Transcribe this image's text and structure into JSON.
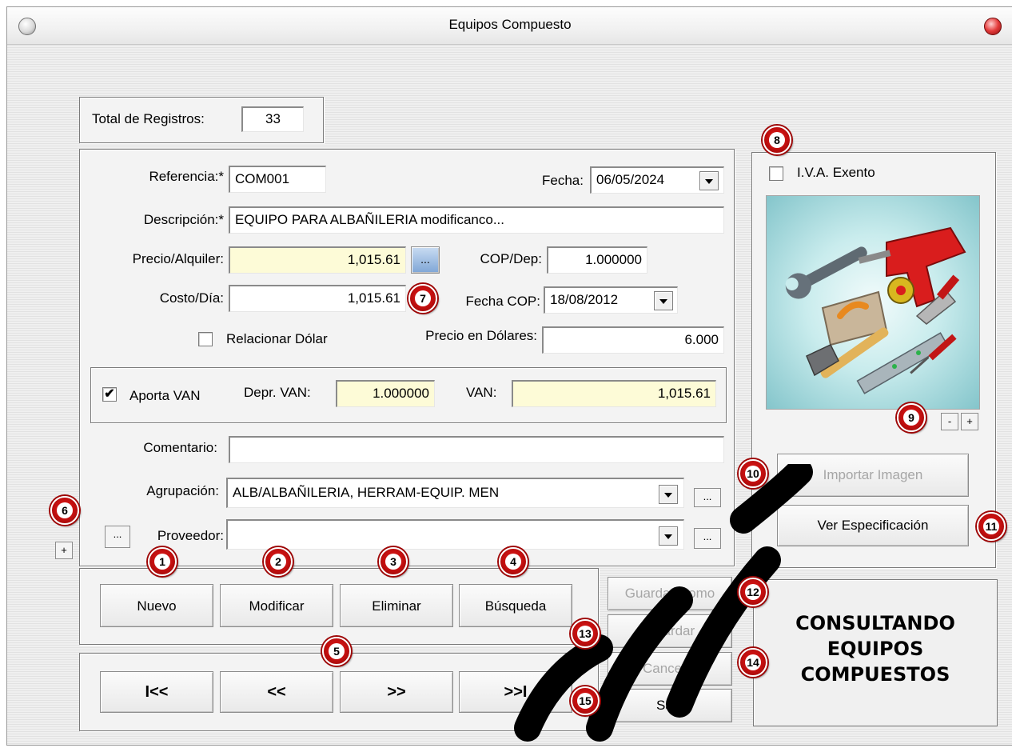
{
  "window": {
    "title": "Equipos Compuesto"
  },
  "total": {
    "label": "Total de Registros:",
    "value": "33"
  },
  "form": {
    "referencia_label": "Referencia:*",
    "referencia_value": "COM001",
    "fecha_label": "Fecha:",
    "fecha_value": "06/05/2024",
    "descripcion_label": "Descripción:*",
    "descripcion_value": "EQUIPO PARA ALBAÑILERIA modificanco...",
    "precio_label": "Precio/Alquiler:",
    "precio_value": "1,015.61",
    "ellipsis": "...",
    "cop_label": "COP/Dep:",
    "cop_value": "1.000000",
    "costo_label": "Costo/Día:",
    "costo_value": "1,015.61",
    "fecha_cop_label": "Fecha COP:",
    "fecha_cop_value": "18/08/2012",
    "relacionar_label": "Relacionar Dólar",
    "precio_dolares_label": "Precio en Dólares:",
    "precio_dolares_value": "6.000",
    "aporta_van_label": "Aporta VAN",
    "aporta_van_checked": true,
    "depr_van_label": "Depr. VAN:",
    "depr_van_value": "1.000000",
    "van_label": "VAN:",
    "van_value": "1,015.61",
    "comentario_label": "Comentario:",
    "comentario_value": "",
    "agrupacion_label": "Agrupación:",
    "agrupacion_value": "ALB/ALBAÑILERIA, HERRAM-EQUIP. MEN",
    "proveedor_label": "Proveedor:",
    "proveedor_value": ""
  },
  "side": {
    "iva_label": "I.V.A. Exento",
    "zoom_minus": "-",
    "zoom_plus": "+",
    "import_image": "Importar Imagen",
    "ver_especificacion": "Ver Especificación"
  },
  "actions": {
    "nuevo": "Nuevo",
    "modificar": "Modificar",
    "eliminar": "Eliminar",
    "busqueda": "Búsqueda",
    "guardar_como": "Guardar Como",
    "guardar": "Guardar",
    "cancelar": "Cancelar",
    "salir": "Salir"
  },
  "navigation": {
    "first": "I<<",
    "prev": "<<",
    "next": ">>",
    "last": ">>I"
  },
  "expand_plus": "+",
  "status": {
    "line1": "CONSULTANDO",
    "line2": "EQUIPOS",
    "line3": "COMPUESTOS"
  },
  "badges": [
    "1",
    "2",
    "3",
    "4",
    "5",
    "6",
    "7",
    "8",
    "9",
    "10",
    "11",
    "12",
    "13",
    "14",
    "15"
  ],
  "colors": {
    "badge": "#c51010",
    "yellow_field": "#fdfbd7",
    "image_bg": "#9fd6da"
  },
  "image_icons": [
    "wrench-icon",
    "drill-icon",
    "trowel-icon",
    "tape-measure-icon",
    "hammer-icon",
    "level-icon",
    "screwdriver-icon",
    "putty-knife-icon"
  ]
}
